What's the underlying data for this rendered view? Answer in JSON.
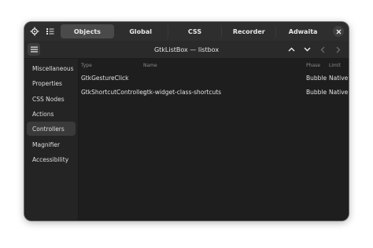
{
  "tabs": [
    {
      "label": "Objects",
      "active": true
    },
    {
      "label": "Global",
      "active": false
    },
    {
      "label": "CSS",
      "active": false
    },
    {
      "label": "Recorder",
      "active": false
    },
    {
      "label": "Adwaita",
      "active": false
    }
  ],
  "subheader": {
    "title": "GtkListBox — listbox"
  },
  "sidebar": {
    "items": [
      {
        "label": "Miscellaneous"
      },
      {
        "label": "Properties"
      },
      {
        "label": "CSS Nodes"
      },
      {
        "label": "Actions"
      },
      {
        "label": "Controllers",
        "selected": true
      },
      {
        "label": "Magnifier"
      },
      {
        "label": "Accessibility"
      }
    ]
  },
  "table": {
    "columns": [
      "Type",
      "Name",
      "Phase",
      "Limit"
    ],
    "rows": [
      [
        "GtkGestureClick",
        "",
        "Bubble",
        "Native"
      ],
      [
        "GtkShortcutController",
        "gtk-widget-class-shortcuts",
        "Bubble",
        "Native"
      ]
    ]
  },
  "icons": {
    "inspect": "crosshair-icon",
    "object_tree": "list-tree-icon",
    "close": "close-icon",
    "menu": "hamburger-menu-icon",
    "up": "chevron-up-icon",
    "down": "chevron-down-icon",
    "back": "chevron-left-icon",
    "forward": "chevron-right-icon"
  },
  "colors": {
    "window_bg": "#242424",
    "headerbar_bg": "#2e2e2e",
    "active_tab_bg": "#4a4a4a",
    "content_bg": "#1e1e1e",
    "text": "#e2e2e2",
    "muted_text": "#8a8a8a"
  }
}
